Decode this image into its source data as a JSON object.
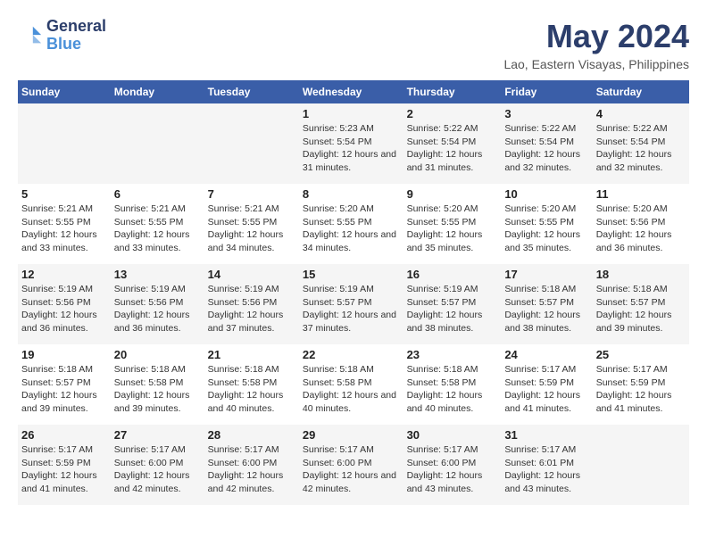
{
  "logo": {
    "line1": "General",
    "line2": "Blue"
  },
  "title": "May 2024",
  "location": "Lao, Eastern Visayas, Philippines",
  "days_header": [
    "Sunday",
    "Monday",
    "Tuesday",
    "Wednesday",
    "Thursday",
    "Friday",
    "Saturday"
  ],
  "weeks": [
    [
      {
        "day": "",
        "sunrise": "",
        "sunset": "",
        "daylight": ""
      },
      {
        "day": "",
        "sunrise": "",
        "sunset": "",
        "daylight": ""
      },
      {
        "day": "",
        "sunrise": "",
        "sunset": "",
        "daylight": ""
      },
      {
        "day": "1",
        "sunrise": "Sunrise: 5:23 AM",
        "sunset": "Sunset: 5:54 PM",
        "daylight": "Daylight: 12 hours and 31 minutes."
      },
      {
        "day": "2",
        "sunrise": "Sunrise: 5:22 AM",
        "sunset": "Sunset: 5:54 PM",
        "daylight": "Daylight: 12 hours and 31 minutes."
      },
      {
        "day": "3",
        "sunrise": "Sunrise: 5:22 AM",
        "sunset": "Sunset: 5:54 PM",
        "daylight": "Daylight: 12 hours and 32 minutes."
      },
      {
        "day": "4",
        "sunrise": "Sunrise: 5:22 AM",
        "sunset": "Sunset: 5:54 PM",
        "daylight": "Daylight: 12 hours and 32 minutes."
      }
    ],
    [
      {
        "day": "5",
        "sunrise": "Sunrise: 5:21 AM",
        "sunset": "Sunset: 5:55 PM",
        "daylight": "Daylight: 12 hours and 33 minutes."
      },
      {
        "day": "6",
        "sunrise": "Sunrise: 5:21 AM",
        "sunset": "Sunset: 5:55 PM",
        "daylight": "Daylight: 12 hours and 33 minutes."
      },
      {
        "day": "7",
        "sunrise": "Sunrise: 5:21 AM",
        "sunset": "Sunset: 5:55 PM",
        "daylight": "Daylight: 12 hours and 34 minutes."
      },
      {
        "day": "8",
        "sunrise": "Sunrise: 5:20 AM",
        "sunset": "Sunset: 5:55 PM",
        "daylight": "Daylight: 12 hours and 34 minutes."
      },
      {
        "day": "9",
        "sunrise": "Sunrise: 5:20 AM",
        "sunset": "Sunset: 5:55 PM",
        "daylight": "Daylight: 12 hours and 35 minutes."
      },
      {
        "day": "10",
        "sunrise": "Sunrise: 5:20 AM",
        "sunset": "Sunset: 5:55 PM",
        "daylight": "Daylight: 12 hours and 35 minutes."
      },
      {
        "day": "11",
        "sunrise": "Sunrise: 5:20 AM",
        "sunset": "Sunset: 5:56 PM",
        "daylight": "Daylight: 12 hours and 36 minutes."
      }
    ],
    [
      {
        "day": "12",
        "sunrise": "Sunrise: 5:19 AM",
        "sunset": "Sunset: 5:56 PM",
        "daylight": "Daylight: 12 hours and 36 minutes."
      },
      {
        "day": "13",
        "sunrise": "Sunrise: 5:19 AM",
        "sunset": "Sunset: 5:56 PM",
        "daylight": "Daylight: 12 hours and 36 minutes."
      },
      {
        "day": "14",
        "sunrise": "Sunrise: 5:19 AM",
        "sunset": "Sunset: 5:56 PM",
        "daylight": "Daylight: 12 hours and 37 minutes."
      },
      {
        "day": "15",
        "sunrise": "Sunrise: 5:19 AM",
        "sunset": "Sunset: 5:57 PM",
        "daylight": "Daylight: 12 hours and 37 minutes."
      },
      {
        "day": "16",
        "sunrise": "Sunrise: 5:19 AM",
        "sunset": "Sunset: 5:57 PM",
        "daylight": "Daylight: 12 hours and 38 minutes."
      },
      {
        "day": "17",
        "sunrise": "Sunrise: 5:18 AM",
        "sunset": "Sunset: 5:57 PM",
        "daylight": "Daylight: 12 hours and 38 minutes."
      },
      {
        "day": "18",
        "sunrise": "Sunrise: 5:18 AM",
        "sunset": "Sunset: 5:57 PM",
        "daylight": "Daylight: 12 hours and 39 minutes."
      }
    ],
    [
      {
        "day": "19",
        "sunrise": "Sunrise: 5:18 AM",
        "sunset": "Sunset: 5:57 PM",
        "daylight": "Daylight: 12 hours and 39 minutes."
      },
      {
        "day": "20",
        "sunrise": "Sunrise: 5:18 AM",
        "sunset": "Sunset: 5:58 PM",
        "daylight": "Daylight: 12 hours and 39 minutes."
      },
      {
        "day": "21",
        "sunrise": "Sunrise: 5:18 AM",
        "sunset": "Sunset: 5:58 PM",
        "daylight": "Daylight: 12 hours and 40 minutes."
      },
      {
        "day": "22",
        "sunrise": "Sunrise: 5:18 AM",
        "sunset": "Sunset: 5:58 PM",
        "daylight": "Daylight: 12 hours and 40 minutes."
      },
      {
        "day": "23",
        "sunrise": "Sunrise: 5:18 AM",
        "sunset": "Sunset: 5:58 PM",
        "daylight": "Daylight: 12 hours and 40 minutes."
      },
      {
        "day": "24",
        "sunrise": "Sunrise: 5:17 AM",
        "sunset": "Sunset: 5:59 PM",
        "daylight": "Daylight: 12 hours and 41 minutes."
      },
      {
        "day": "25",
        "sunrise": "Sunrise: 5:17 AM",
        "sunset": "Sunset: 5:59 PM",
        "daylight": "Daylight: 12 hours and 41 minutes."
      }
    ],
    [
      {
        "day": "26",
        "sunrise": "Sunrise: 5:17 AM",
        "sunset": "Sunset: 5:59 PM",
        "daylight": "Daylight: 12 hours and 41 minutes."
      },
      {
        "day": "27",
        "sunrise": "Sunrise: 5:17 AM",
        "sunset": "Sunset: 6:00 PM",
        "daylight": "Daylight: 12 hours and 42 minutes."
      },
      {
        "day": "28",
        "sunrise": "Sunrise: 5:17 AM",
        "sunset": "Sunset: 6:00 PM",
        "daylight": "Daylight: 12 hours and 42 minutes."
      },
      {
        "day": "29",
        "sunrise": "Sunrise: 5:17 AM",
        "sunset": "Sunset: 6:00 PM",
        "daylight": "Daylight: 12 hours and 42 minutes."
      },
      {
        "day": "30",
        "sunrise": "Sunrise: 5:17 AM",
        "sunset": "Sunset: 6:00 PM",
        "daylight": "Daylight: 12 hours and 43 minutes."
      },
      {
        "day": "31",
        "sunrise": "Sunrise: 5:17 AM",
        "sunset": "Sunset: 6:01 PM",
        "daylight": "Daylight: 12 hours and 43 minutes."
      },
      {
        "day": "",
        "sunrise": "",
        "sunset": "",
        "daylight": ""
      }
    ]
  ]
}
